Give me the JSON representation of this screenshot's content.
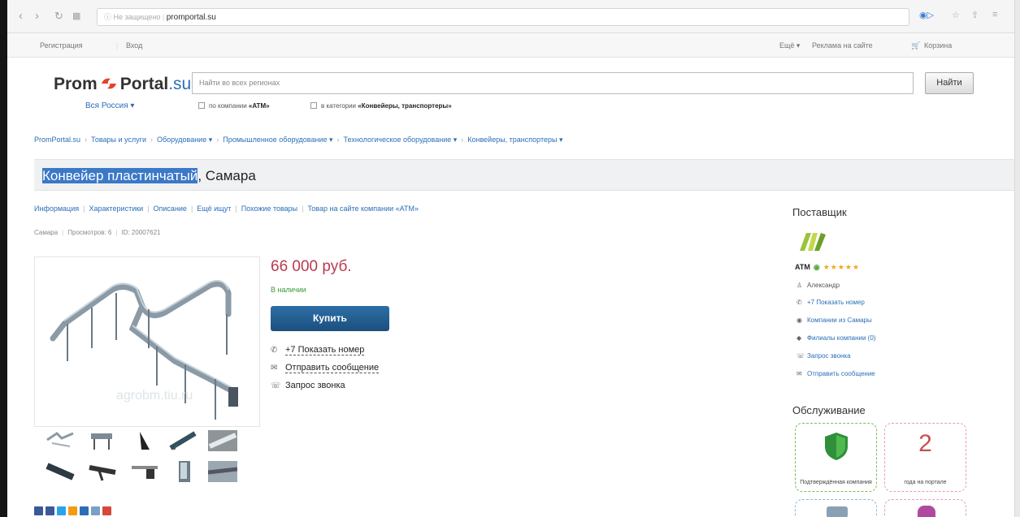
{
  "browser": {
    "secure_label": "Не защищено",
    "url_domain": "promportal.su"
  },
  "topbar": {
    "register": "Регистрация",
    "login": "Вход",
    "more": "Ещё ▾",
    "ads": "Реклама на сайте",
    "cart": "Корзина"
  },
  "header": {
    "logo_prom": "Prom",
    "logo_portal": "Portal",
    "logo_su": ".su",
    "region": "Вся Россия ▾",
    "search_placeholder": "Найти во всех регионах",
    "search_button": "Найти",
    "filter_company_prefix": "по компании",
    "filter_company_name": "«ATM»",
    "filter_category_prefix": "в категории",
    "filter_category_name": "«Конвейеры, транспортеры»"
  },
  "breadcrumbs": [
    "PromPortal.su",
    "Товары и услуги",
    "Оборудование ▾",
    "Промышленное оборудование ▾",
    "Технологическое оборудование ▾",
    "Конвейеры, транспортеры ▾"
  ],
  "title": {
    "highlighted": "Конвейер пластинчатый",
    "rest": ", Самара"
  },
  "tabs": [
    "Информация",
    "Характеристики",
    "Описание",
    "Ещё ищут",
    "Похожие товары",
    "Товар на сайте компании «ATM»"
  ],
  "meta": {
    "city": "Самара",
    "views": "Просмотров: 6",
    "id": "ID: 20007621"
  },
  "gallery": {
    "watermark": "agrobm.tiu.ru"
  },
  "offer": {
    "price": "66 000 руб.",
    "stock": "В наличии",
    "buy_button": "Купить",
    "actions": [
      {
        "icon": "phone-icon",
        "glyph": "✆",
        "label": "+7 Показать номер"
      },
      {
        "icon": "envelope-icon",
        "glyph": "✉",
        "label": "Отправить сообщение"
      },
      {
        "icon": "callback-icon",
        "glyph": "☏",
        "label": "Запрос звонка"
      }
    ]
  },
  "supplier": {
    "heading": "Поставщик",
    "name": "ATM",
    "stars": "★★★★★",
    "items": [
      {
        "icon": "person-icon",
        "glyph": "👤",
        "label": "Александр",
        "link": false
      },
      {
        "icon": "phone-icon",
        "glyph": "✆",
        "label": "+7 Показать номер",
        "link": true
      },
      {
        "icon": "pin-icon",
        "glyph": "◉",
        "label": "Компании из Самары",
        "link": true
      },
      {
        "icon": "tag-icon",
        "glyph": "◆",
        "label": "Филиалы компании (0)",
        "link": true
      },
      {
        "icon": "callback-icon",
        "glyph": "☏",
        "label": "Запрос звонка",
        "link": true
      },
      {
        "icon": "envelope-icon",
        "glyph": "✉",
        "label": "Отправить сообщение",
        "link": true
      }
    ]
  },
  "service": {
    "heading": "Обслуживание",
    "cards": [
      {
        "label": "Подтверждённая компания",
        "border": "#7bbf5a"
      },
      {
        "number": "2",
        "label": "года на портале",
        "border": "#e9a0a0"
      }
    ]
  },
  "colors": {
    "link": "#2a6fb7",
    "price": "#b83a50",
    "stock": "#3a9a35",
    "buy_button": "#1c4f7e",
    "title_highlight": "#3b78c8"
  }
}
